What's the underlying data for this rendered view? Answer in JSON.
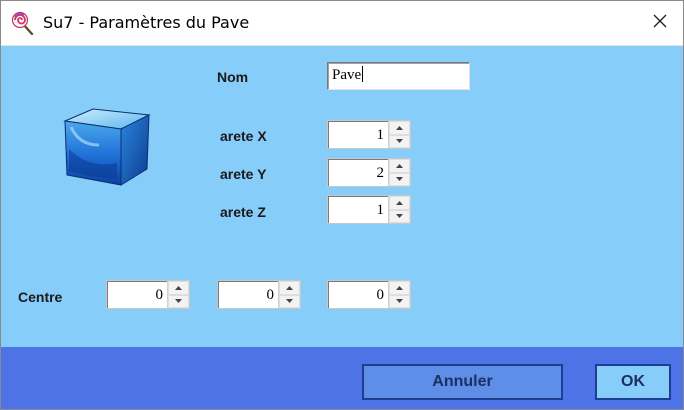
{
  "window": {
    "title": "Su7 - Paramètres du Pave",
    "app_icon": "lollipop-icon",
    "close_icon": "close-icon"
  },
  "form": {
    "name_label": "Nom",
    "name_value": "Pave",
    "preview_icon": "cube-3d-icon",
    "dimensions": [
      {
        "label": "arete X",
        "value": "1"
      },
      {
        "label": "arete Y",
        "value": "2"
      },
      {
        "label": "arete Z",
        "value": "1"
      }
    ],
    "center_label": "Centre",
    "center": [
      "0",
      "0",
      "0"
    ]
  },
  "footer": {
    "cancel_label": "Annuler",
    "ok_label": "OK"
  },
  "colors": {
    "dialog_background": "#87cdf9",
    "footer_background": "#4d73e6",
    "cancel_button": "#5d8ee8",
    "ok_button": "#87cdf9"
  }
}
